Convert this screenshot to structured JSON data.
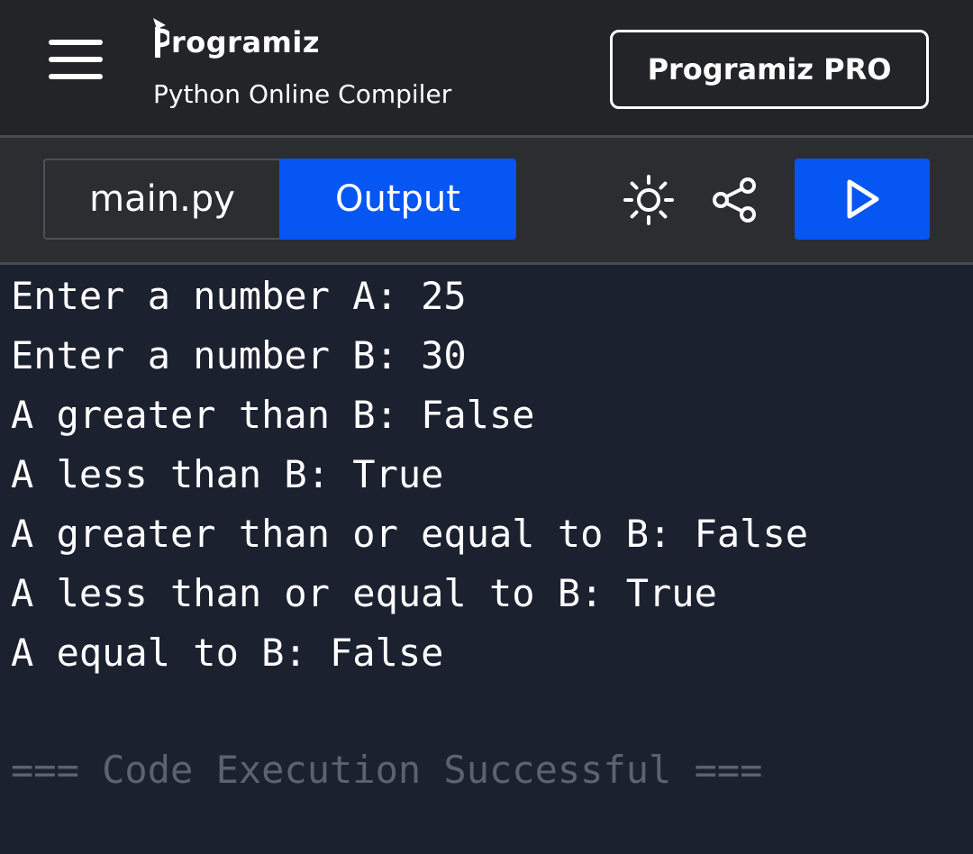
{
  "header": {
    "logo_text": "rogramiz",
    "subtitle": "Python Online Compiler",
    "pro_button_label": "Programiz PRO"
  },
  "toolbar": {
    "tabs": [
      {
        "label": "main.py",
        "active": false
      },
      {
        "label": "Output",
        "active": true
      }
    ],
    "icons": [
      "theme-toggle-sun-icon",
      "share-icon",
      "play-icon"
    ]
  },
  "console": {
    "lines": [
      "Enter a number A: 25",
      "Enter a number B: 30",
      "A greater than B: False",
      "A less than B: True",
      "A greater than or equal to B: False",
      "A less than or equal to B: True",
      "A equal to B: False"
    ],
    "success_message": "=== Code Execution Successful ==="
  },
  "colors": {
    "accent": "#0556f3",
    "header_bg": "#232428",
    "toolbar_bg": "#2c2d31",
    "console_bg": "#1c2130",
    "muted_text": "#5c6270"
  }
}
